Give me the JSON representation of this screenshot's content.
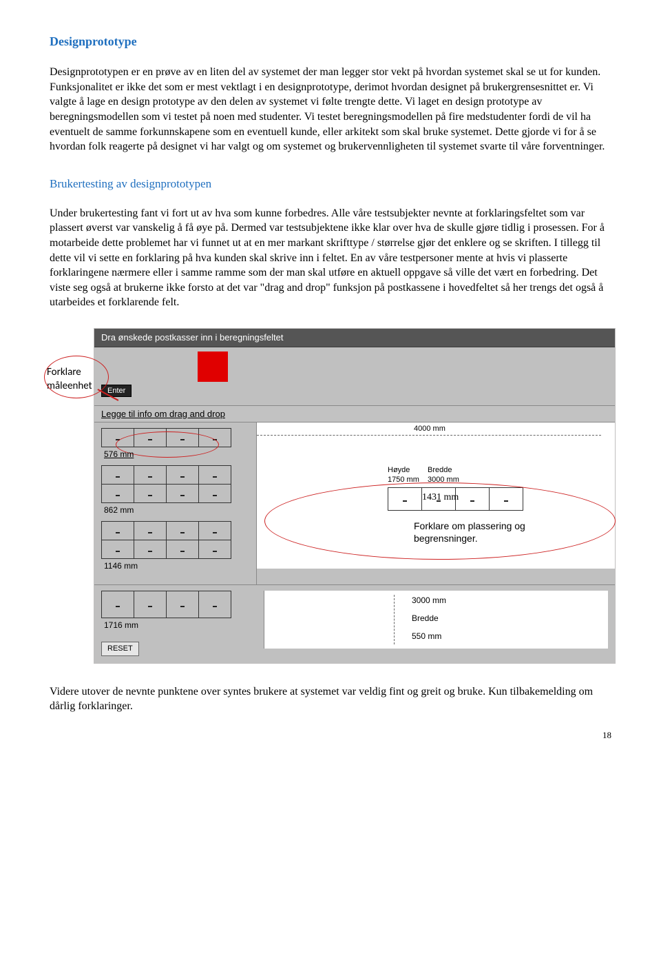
{
  "heading1": "Designprototype",
  "para1": "Designprototypen er en prøve av en liten del av systemet der man legger stor vekt på hvordan systemet skal se ut for kunden. Funksjonalitet er ikke det som er mest vektlagt i en designprototype, derimot hvordan designet på brukergrensesnittet er. Vi valgte å lage en design prototype av den delen av systemet vi følte trengte dette. Vi laget en design prototype av beregningsmodellen som vi testet på noen med studenter. Vi testet beregningsmodellen på fire medstudenter fordi de vil ha eventuelt de samme forkunnskapene som en eventuell kunde, eller arkitekt som skal bruke systemet. Dette gjorde vi for å se hvordan folk reagerte på designet vi har valgt og om systemet og brukervennligheten til systemet svarte til våre forventninger.",
  "heading2": "Brukertesting av designprototypen",
  "para2": "Under brukertesting fant vi fort ut av hva som kunne forbedres. Alle våre testsubjekter nevnte at forklaringsfeltet som var plassert øverst var vanskelig å få øye på. Dermed var testsubjektene ikke klar over hva de skulle gjøre tidlig i prosessen. For å motarbeide dette problemet har vi funnet ut at en mer markant skrifttype / størrelse gjør det enklere og se skriften. I tillegg til dette vil vi sette en forklaring på hva kunden skal skrive inn i feltet. En av våre testpersoner mente at hvis vi plasserte forklaringene nærmere eller i samme ramme som der man skal utføre en aktuell oppgave så ville det vært en forbedring. Det viste seg også at brukerne ikke forsto at det var \"drag and drop\" funksjon på postkassene i hovedfeltet så her trengs det også å utarbeides et forklarende felt.",
  "para3": "Videre utover de nevnte punktene over syntes brukere at systemet var veldig fint og greit og bruke. Kun tilbakemelding om dårlig forklaringer.",
  "page_number": "18",
  "proto": {
    "title_bar": "Dra ønskede postkasser inn i beregningsfeltet",
    "enter_btn": "Enter",
    "info_bar": "Legge til info om drag and drop",
    "callout_left": "Forklare måleenhet",
    "sizes": {
      "s1": "576 mm",
      "s2": "862 mm",
      "s3": "1146 mm",
      "s4": "1716 mm"
    },
    "right": {
      "topmeasure": "4000 mm",
      "hoyde_label": "Høyde",
      "hoyde_val": "1750 mm",
      "bredde_label": "Bredde",
      "bredde_val": "3000 mm",
      "rack_label": "1431 mm",
      "note_line1": "Forklare om plassering og",
      "note_line2": "begrensninger."
    },
    "bottom": {
      "b1": "3000 mm",
      "b2": "Bredde",
      "b3": "550 mm"
    },
    "reset": "RESET"
  }
}
